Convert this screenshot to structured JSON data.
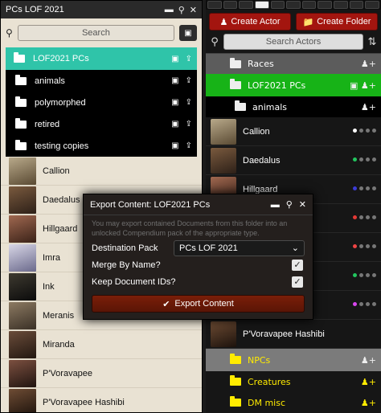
{
  "actors_panel": {
    "create_actor": "Create Actor",
    "create_folder": "Create Folder",
    "search_placeholder": "Search Actors",
    "folders": {
      "races": "Races",
      "pcs": "LOF2021 PCs",
      "animals": "animals",
      "npcs": "NPCs",
      "creatures": "Creatures",
      "dm_misc": "DM misc"
    },
    "actors": [
      {
        "name": "Callion",
        "dot": "#ffffff"
      },
      {
        "name": "Daedalus",
        "dot": "#22c55e"
      },
      {
        "name": "Hillgaard",
        "dot": "#3b3bd6"
      },
      {
        "name": "",
        "dot": "#e53935"
      },
      {
        "name": "",
        "dot": "#ef4444"
      },
      {
        "name": "",
        "dot": "#22c55e"
      },
      {
        "name": "",
        "dot": "#d946ef"
      },
      {
        "name": "P'Voravapee Hashibi",
        "dot": ""
      }
    ]
  },
  "folder_window": {
    "title": "PCs LOF 2021",
    "search_placeholder": "Search",
    "folders": {
      "root": "LOF2021 PCs",
      "sub": [
        "animals",
        "polymorphed",
        "retired",
        "testing copies"
      ]
    },
    "actors": [
      "Callion",
      "Daedalus",
      "Hillgaard",
      "Imra",
      "Ink",
      "Meranis",
      "Miranda",
      "P'Voravapee",
      "P'Voravapee Hashibi"
    ]
  },
  "export_dialog": {
    "title": "Export Content: LOF2021 PCs",
    "hint": "You may export contained Documents from this folder into an unlocked Compendium pack of the appropriate type.",
    "destination_label": "Destination Pack",
    "destination_value": "PCs LOF 2021",
    "merge_label": "Merge By Name?",
    "merge_checked": true,
    "keep_ids_label": "Keep Document IDs?",
    "keep_ids_checked": true,
    "export_label": "Export Content"
  },
  "colors": {
    "teal_folder": "#2fc4a9",
    "green_folder": "#17b317",
    "actor_button": "#a3150f",
    "npc_text": "#ffeb00"
  }
}
